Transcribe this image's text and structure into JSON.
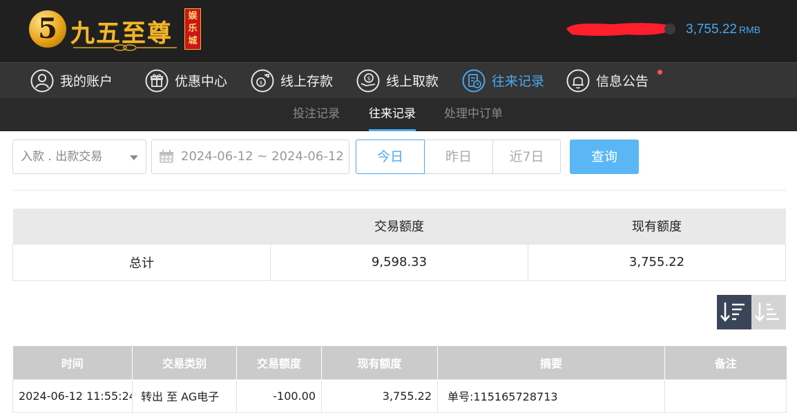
{
  "header": {
    "logo_numeral": "5",
    "logo_name": "九五至尊",
    "logo_badge": [
      "娱",
      "乐",
      "城"
    ],
    "balance_value": "3,755.22",
    "balance_currency": "RMB"
  },
  "mainnav": {
    "items": [
      {
        "label": "我的账户",
        "icon": "user-icon"
      },
      {
        "label": "优惠中心",
        "icon": "gift-icon"
      },
      {
        "label": "线上存款",
        "icon": "deposit-icon"
      },
      {
        "label": "线上取款",
        "icon": "withdraw-icon"
      },
      {
        "label": "往来记录",
        "icon": "records-icon",
        "active": true
      },
      {
        "label": "信息公告",
        "icon": "bell-icon"
      }
    ]
  },
  "subnav": {
    "items": [
      {
        "label": "投注记录"
      },
      {
        "label": "往来记录",
        "active": true
      },
      {
        "label": "处理中订单"
      }
    ]
  },
  "filters": {
    "type_select": "入款 . 出款交易",
    "date_range": "2024-06-12 ~ 2024-06-12",
    "quick_ranges": [
      "今日",
      "昨日",
      "近7日"
    ],
    "active_range": "今日",
    "query_label": "查询"
  },
  "summary": {
    "headers": [
      "",
      "交易额度",
      "现有额度"
    ],
    "row": {
      "label": "总计",
      "amount": "9,598.33",
      "balance": "3,755.22"
    }
  },
  "records": {
    "headers": [
      "时间",
      "交易类别",
      "交易额度",
      "现有额度",
      "摘要",
      "备注"
    ],
    "rows": [
      {
        "time": "2024-06-12 11:55:24",
        "type": "转出 至 AG电子",
        "amount": "-100.00",
        "balance": "3,755.22",
        "summary": "单号:115165728713",
        "note": ""
      }
    ]
  },
  "colors": {
    "accent": "#4aa8f0",
    "query_button": "#5bb6f5",
    "header_bg": "#202020",
    "nav_bg": "#353535",
    "sort_active": "#3a4658",
    "notify_dot": "#ff4f64"
  }
}
